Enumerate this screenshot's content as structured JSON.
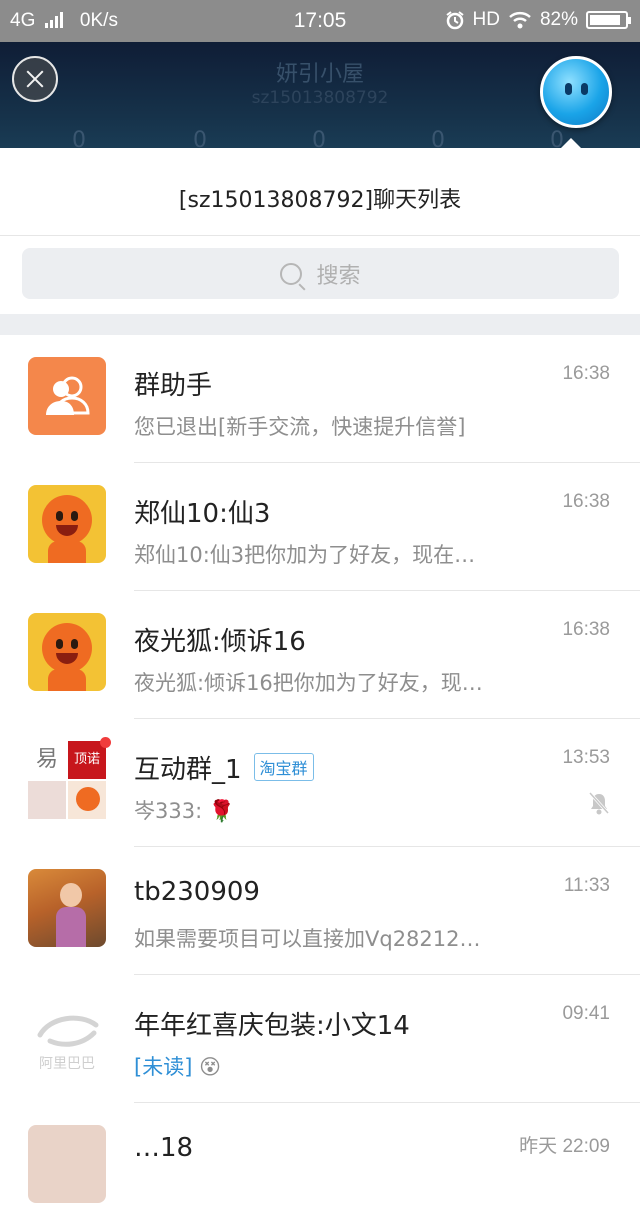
{
  "status_bar": {
    "network": "4G",
    "speed": "0K/s",
    "time": "17:05",
    "hd": "HD",
    "battery": "82%"
  },
  "header": {
    "shop_name": "妍引小屋",
    "account": "sz15013808792",
    "counters": [
      "0",
      "0",
      "0",
      "0",
      "0"
    ]
  },
  "panel": {
    "title": "[sz15013808792]聊天列表",
    "search_placeholder": "搜索"
  },
  "chats": [
    {
      "name": "群助手",
      "message": "您已退出[新手交流，快速提升信誉]",
      "time": "16:38",
      "avatar": "group-helper-icon"
    },
    {
      "name": "郑仙10:仙3",
      "message": "郑仙10:仙3把你加为了好友，现在…",
      "time": "16:38",
      "avatar": "mascot-avatar"
    },
    {
      "name": "夜光狐:倾诉16",
      "message": "夜光狐:倾诉16把你加为了好友，现…",
      "time": "16:38",
      "avatar": "mascot-avatar"
    },
    {
      "name": "互动群_1",
      "tag": "淘宝群",
      "message": "岑333:",
      "emoji": "🌹",
      "time": "13:53",
      "muted": true,
      "avatar": "group-collage-avatar",
      "collage_texts": [
        "易",
        "顶诺"
      ]
    },
    {
      "name": "tb230909",
      "message": "如果需要项目可以直接加Vq28212…",
      "time": "11:33",
      "avatar": "photo-avatar"
    },
    {
      "name": "年年红喜庆包装:小文14",
      "unread_label": "[未读]",
      "emoji": "😵",
      "time": "09:41",
      "avatar": "alibaba-logo",
      "logo_text": "阿里巴巴"
    },
    {
      "name": "…18",
      "message": "",
      "time": "昨天 22:09",
      "avatar": "photo-avatar"
    }
  ],
  "colors": {
    "header_bg": "#16324a",
    "statusbar_bg": "#8c8c8c",
    "accent": "#2f8fd6",
    "orange": "#f4874b"
  }
}
